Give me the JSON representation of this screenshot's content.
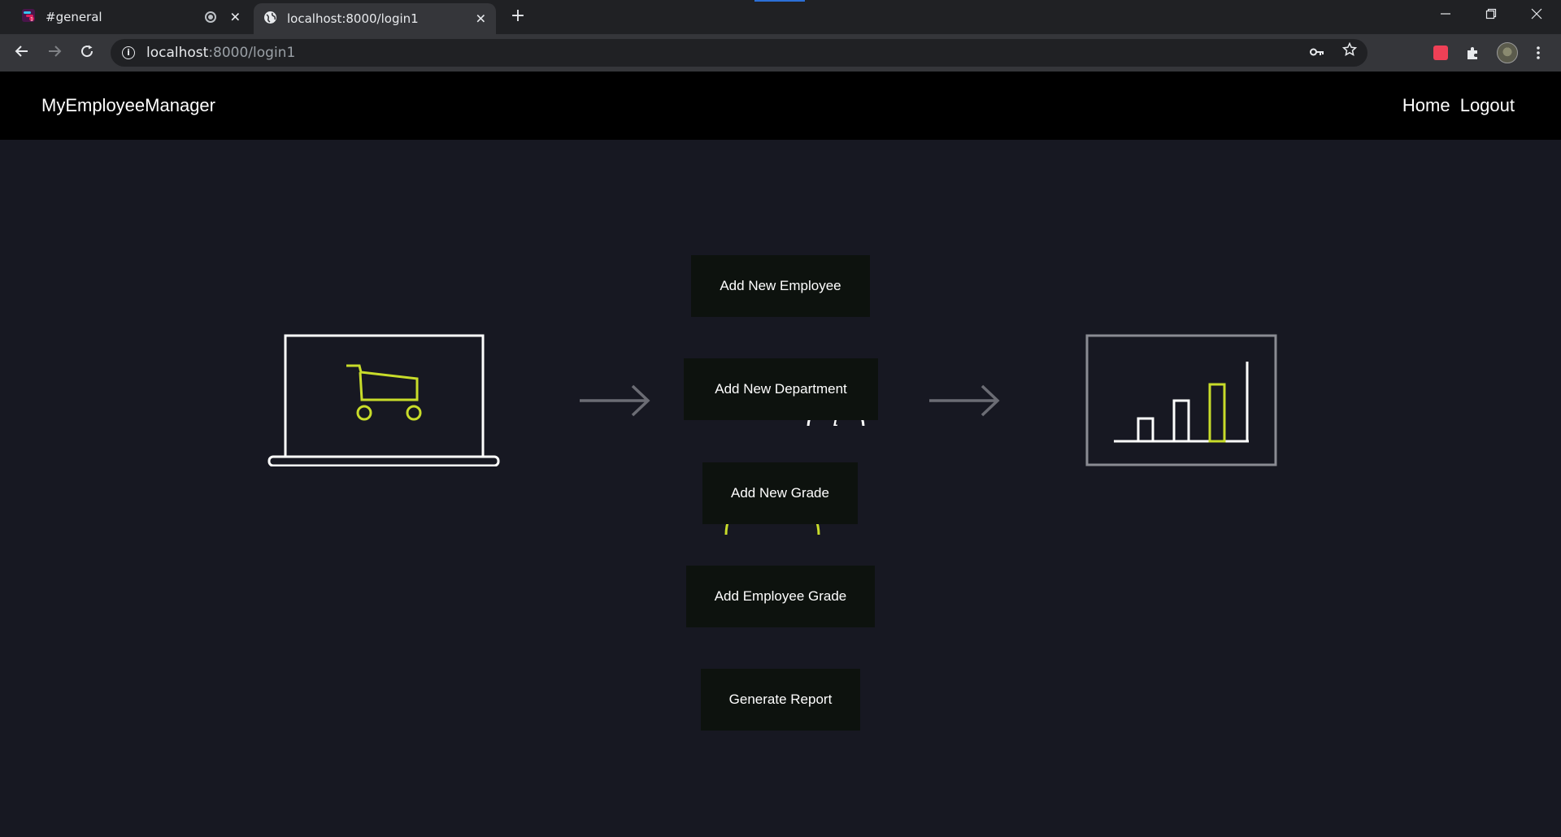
{
  "browser": {
    "tabs": [
      {
        "title": "#general",
        "icon": "slack-app-icon"
      },
      {
        "title": "localhost:8000/login1",
        "icon": "globe-icon"
      }
    ],
    "url_host": "localhost",
    "url_path": ":8000/login1"
  },
  "header": {
    "brand": "MyEmployeeManager",
    "nav": {
      "home": "Home",
      "logout": "Logout"
    }
  },
  "actions": {
    "add_employee": "Add New Employee",
    "add_department": "Add New Department",
    "add_grade": "Add New Grade",
    "add_employee_grade": "Add Employee Grade",
    "generate_report": "Generate Report"
  },
  "colors": {
    "page_background": "#171822",
    "header_background": "#000000",
    "button_background": "#0d120e",
    "accent": "#c8dc2a",
    "outline": "#ffffff",
    "arrow": "#6b6c74"
  }
}
